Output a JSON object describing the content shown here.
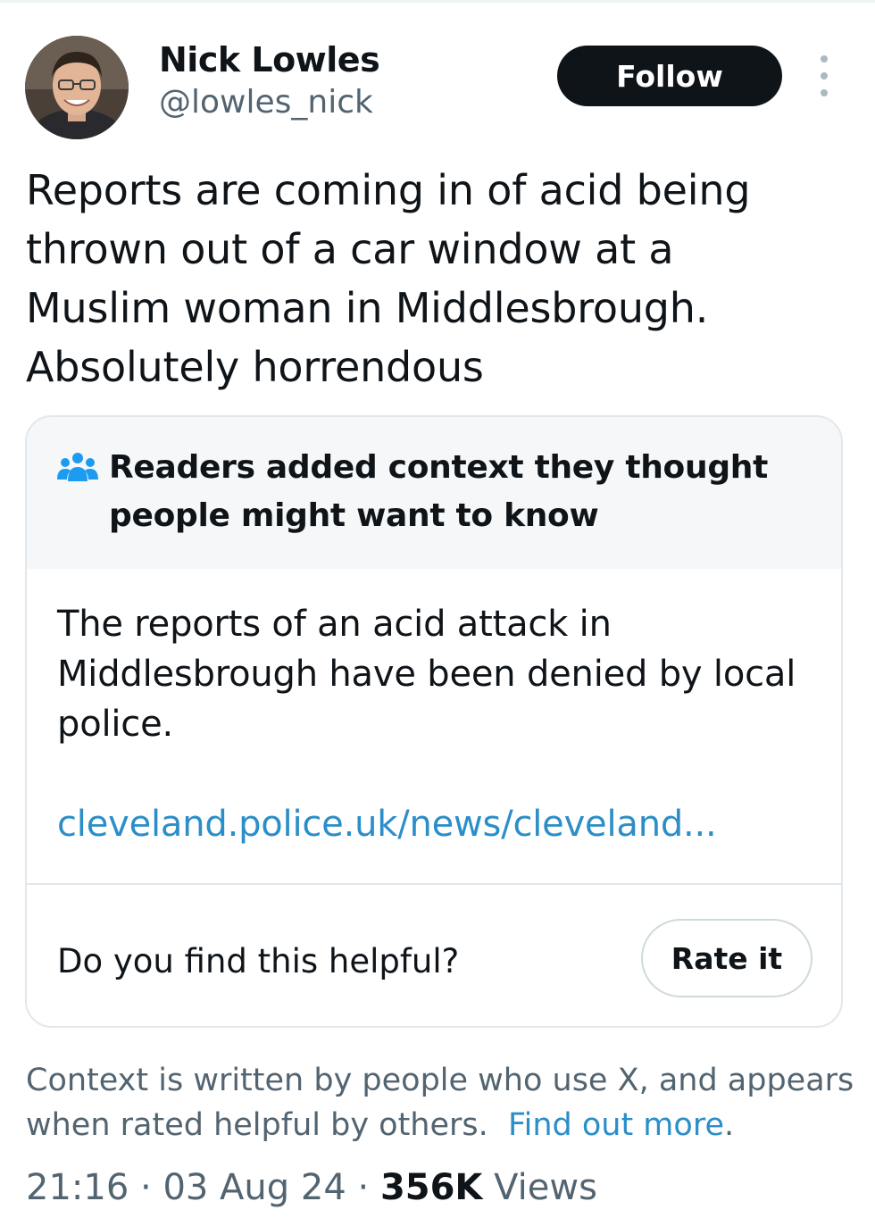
{
  "author": {
    "display_name": "Nick Lowles",
    "handle": "@lowles_nick"
  },
  "actions": {
    "follow_label": "Follow"
  },
  "tweet": {
    "text": "Reports are coming in of acid being\nthrown out of a car window at a\nMuslim woman in Middlesbrough.\nAbsolutely horrendous"
  },
  "community_note": {
    "title": "Readers added context they thought people might want to know",
    "body": "The reports of an acid attack in Middlesbrough have been denied by local police.",
    "link": "cleveland.police.uk/news/cleveland...",
    "helpful_question": "Do you find this helpful?",
    "rate_label": "Rate it"
  },
  "footer": {
    "context_text": "Context is written by people who use X, and appears when rated helpful by others.",
    "find_out_more": "Find out more",
    "period": "."
  },
  "meta": {
    "time": "21:16",
    "date": "03 Aug 24",
    "separator": "·",
    "views_count": "356K",
    "views_label": "Views"
  },
  "icons": {
    "note_icon": "people-icon",
    "more_icon": "more-vertical-icon"
  },
  "colors": {
    "follow_bg": "#0f1419",
    "link": "#2b8ec8",
    "secondary_text": "#536471",
    "note_header_bg": "#f5f7f8"
  }
}
